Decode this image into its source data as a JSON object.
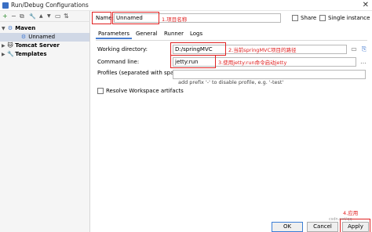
{
  "window": {
    "title": "Run/Debug Configurations",
    "close_symbol": "✕"
  },
  "toolbar": {
    "icons": [
      "add-icon",
      "remove-icon",
      "copy-icon",
      "wrench-icon",
      "move-up-icon",
      "move-down-icon",
      "folder-icon",
      "sort-icon"
    ],
    "glyphs": {
      "add": "+",
      "remove": "−",
      "copy": "⧉",
      "wrench": "🔧",
      "up": "▲",
      "down": "▼",
      "folder": "▭",
      "sort": "⇅"
    }
  },
  "tree": {
    "maven": {
      "arrow": "▼",
      "label": "Maven",
      "icon": "gear-icon",
      "glyph": "⚙",
      "icon_color": "#4a7fd2"
    },
    "unnamed": {
      "label": "Unnamed",
      "icon": "gear-icon",
      "glyph": "⚙",
      "icon_color": "#4a7fd2"
    },
    "tomcat": {
      "arrow": "▶",
      "label": "Tomcat Server",
      "icon": "tomcat-icon",
      "glyph": "🐱"
    },
    "templates": {
      "arrow": "▶",
      "label": "Templates",
      "icon": "wrench-icon",
      "glyph": "🔧"
    }
  },
  "form": {
    "name_label": "Name:",
    "name_value": "Unnamed",
    "name_note": "1.项目名称",
    "share_label": "Share",
    "single_instance_label": "Single instance only",
    "tabs": [
      "Parameters",
      "General",
      "Runner",
      "Logs"
    ],
    "working_dir_label": "Working directory:",
    "working_dir_value": "D:/springMVC",
    "working_dir_note": "2.当前springMVC项目的路径",
    "command_label": "Command line:",
    "command_value": "jetty:run",
    "command_note": "3.使用jetty:run命令启动jetty",
    "profiles_label": "Profiles (separated with space):",
    "profiles_value": "",
    "profiles_hint": "add prefix '-' to disable profile, e.g. '-test'",
    "resolve_label": "Resolve Workspace artifacts",
    "apply_note": "4.应用",
    "folder_glyph": "▭",
    "ellipsis_glyph": "…",
    "tree_glyph": "⎘"
  },
  "buttons": {
    "ok": "OK",
    "cancel": "Cancel",
    "apply": "Apply"
  },
  "watermark": "csdn.net/qq"
}
